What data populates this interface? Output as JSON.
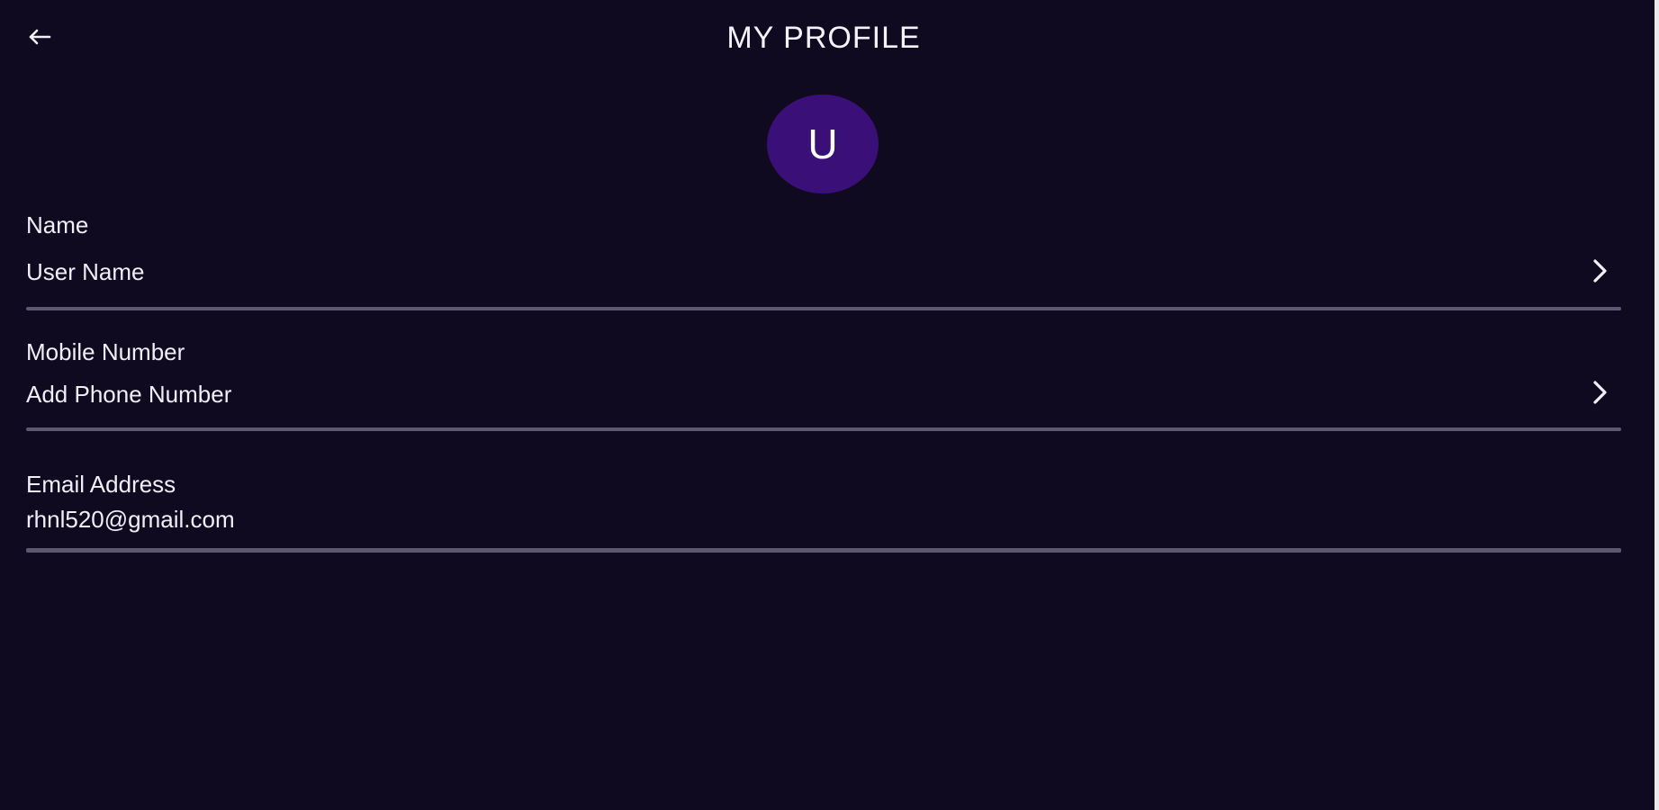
{
  "header": {
    "title": "MY PROFILE",
    "back_icon": "arrow-left-icon"
  },
  "avatar": {
    "initial": "U",
    "color": "#3a0f78"
  },
  "fields": {
    "name": {
      "label": "Name",
      "value": "User Name",
      "action_icon": "chevron-right-icon"
    },
    "mobile": {
      "label": "Mobile Number",
      "value": "Add Phone Number",
      "action_icon": "chevron-right-icon"
    },
    "email": {
      "label": "Email Address",
      "value": "rhnl520@gmail.com"
    }
  },
  "colors": {
    "background": "#0f0a1f",
    "text": "#f0eef6",
    "divider": "#5d5870"
  }
}
